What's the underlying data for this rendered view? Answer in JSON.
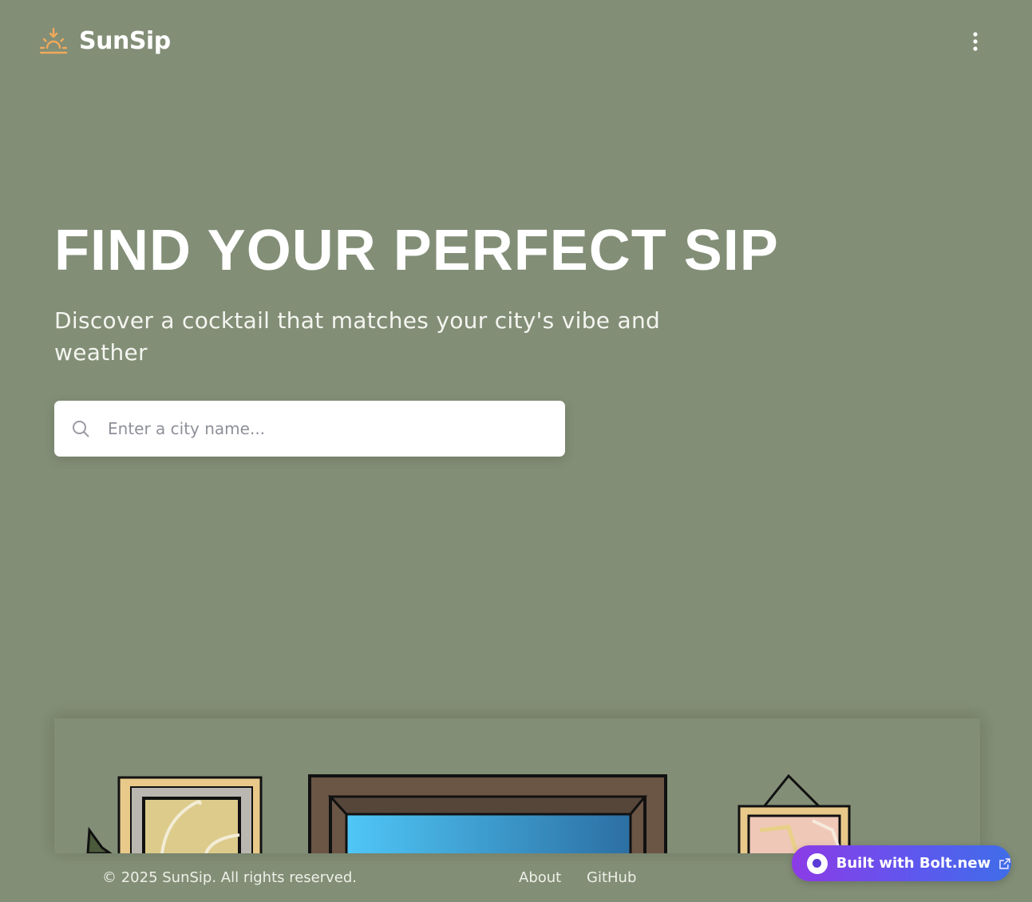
{
  "app": {
    "name": "SunSip"
  },
  "header": {
    "logo_icon": "sunrise-icon",
    "menu_icon": "more-vertical-icon"
  },
  "hero": {
    "title": "FIND YOUR PERFECT SIP",
    "subtitle": "Discover a cocktail that matches your city's vibe and weather"
  },
  "search": {
    "icon": "search-icon",
    "placeholder": "Enter a city name...",
    "value": ""
  },
  "footer": {
    "copyright": "© 2025 SunSip. All rights reserved.",
    "links": [
      {
        "label": "About"
      },
      {
        "label": "GitHub"
      }
    ]
  },
  "badge": {
    "label": "Built with Bolt.new",
    "icon": "external-link-icon"
  },
  "colors": {
    "background": "#828e76",
    "accent": "#f0a95a",
    "text": "#ffffff",
    "badge_start": "#8c3be6",
    "badge_end": "#3f6de8"
  }
}
